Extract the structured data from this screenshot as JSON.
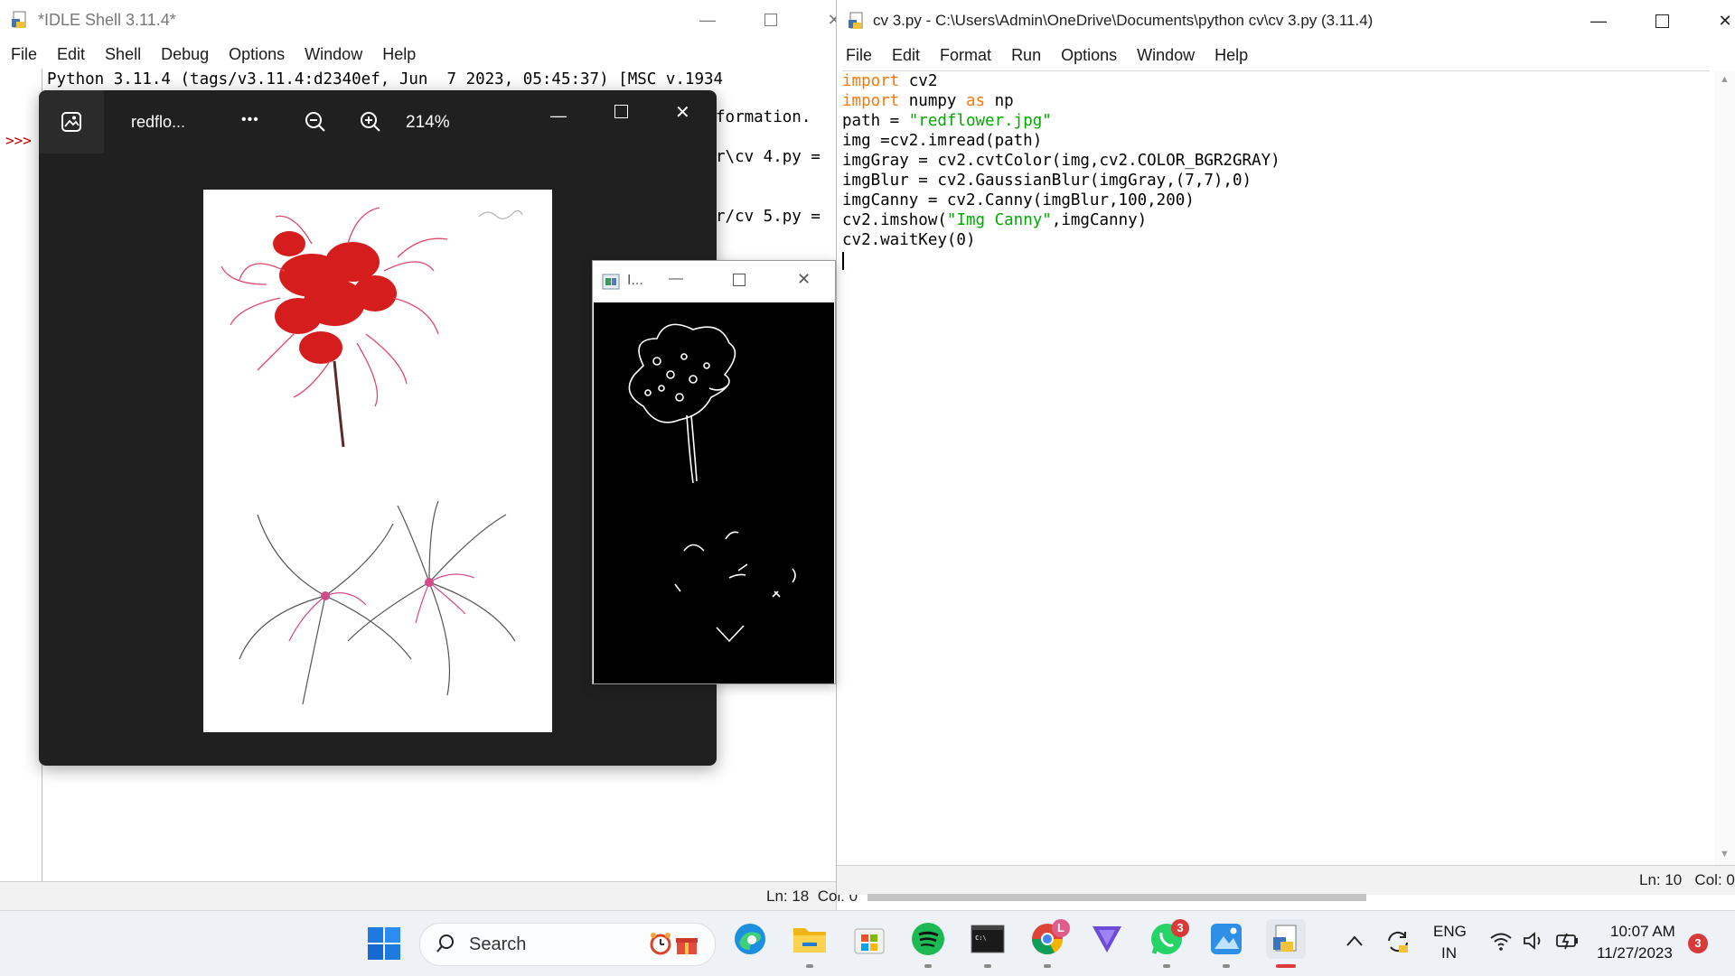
{
  "idle_shell": {
    "title": "*IDLE Shell 3.11.4*",
    "menu": [
      "File",
      "Edit",
      "Shell",
      "Debug",
      "Options",
      "Window",
      "Help"
    ],
    "banner": "Python 3.11.4 (tags/v3.11.4:d2340ef, Jun  7 2023, 05:45:37) [MSC v.1934",
    "info_fragment": "formation.",
    "restart_1": "r\\cv 4.py =",
    "restart_2": "r/cv 5.py =",
    "prompt": ">>>",
    "status": "Ln: 18  Col: 0"
  },
  "photo_viewer": {
    "file_name": "redflo...",
    "more_label": "•••",
    "zoom_level": "214%"
  },
  "canny_window": {
    "title": "I..."
  },
  "editor": {
    "title": "cv 3.py - C:\\Users\\Admin\\OneDrive\\Documents\\python cv\\cv 3.py (3.11.4)",
    "menu": [
      "File",
      "Edit",
      "Format",
      "Run",
      "Options",
      "Window",
      "Help"
    ],
    "code": {
      "l1_kw": "import",
      "l1_rest": " cv2",
      "l2_kw": "import",
      "l2_mid": " numpy ",
      "l2_kw2": "as",
      "l2_rest": " np",
      "l3_pre": "path = ",
      "l3_str": "\"redflower.jpg\"",
      "l4": "img =cv2.imread(path)",
      "l5": "imgGray = cv2.cvtColor(img,cv2.COLOR_BGR2GRAY)",
      "l6": "imgBlur = cv2.GaussianBlur(imgGray,(7,7),0)",
      "l7": "imgCanny = cv2.Canny(imgBlur,100,200)",
      "l8_pre": "cv2.imshow(",
      "l8_str": "\"Img Canny\"",
      "l8_post": ",imgCanny)",
      "l9": "cv2.waitKey(0)"
    },
    "status": "Ln: 10   Col: 0"
  },
  "taskbar": {
    "search_label": "Search",
    "lang_line1": "ENG",
    "lang_line2": "IN",
    "time": "10:07 AM",
    "date": "11/27/2023",
    "notification_count": "3",
    "whatsapp_badge": "3",
    "chrome_badge": "L"
  },
  "colors": {
    "keyword": "#ff7700",
    "string": "#00aa00",
    "viewer_bg": "#202020",
    "taskbar_bg": "#eef1f6"
  }
}
